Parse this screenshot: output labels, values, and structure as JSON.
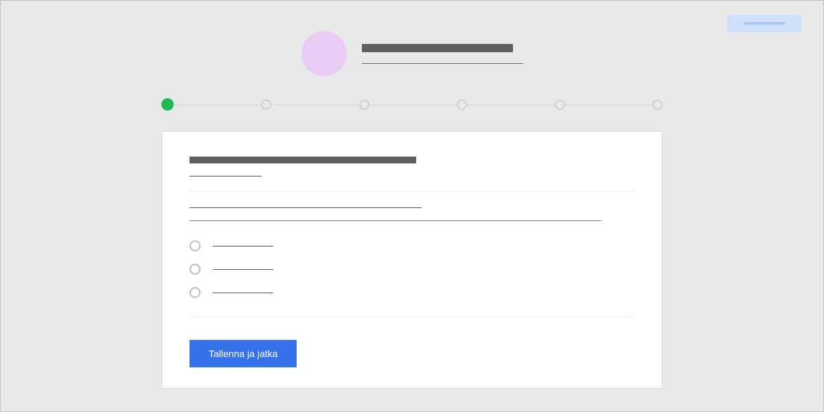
{
  "header": {
    "title_placeholder": "",
    "subtitle_placeholder": ""
  },
  "stepper": {
    "total_steps": 6,
    "current_step": 1
  },
  "form": {
    "section_title_placeholder": "",
    "section_subtitle_placeholder": "",
    "field_label_placeholder": "",
    "input_value": "",
    "radio_options": [
      {
        "label_placeholder": ""
      },
      {
        "label_placeholder": ""
      },
      {
        "label_placeholder": ""
      }
    ],
    "submit_label": "Tallenna ja jatka"
  },
  "top_badge": {
    "text_placeholder": ""
  }
}
